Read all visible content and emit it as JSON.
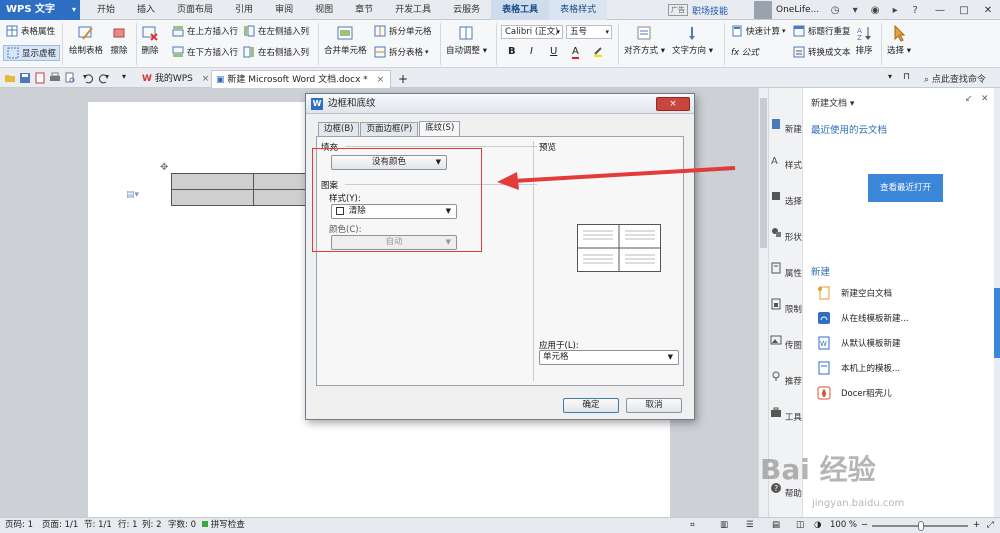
{
  "titlebar": {
    "app_name": "WPS 文字",
    "menu_tabs": [
      "开始",
      "插入",
      "页面布局",
      "引用",
      "审阅",
      "视图",
      "章节",
      "开发工具",
      "云服务",
      "表格工具",
      "表格样式"
    ],
    "ad_badge": "广告",
    "career_link": "职场技能",
    "user_name": "OneLife..."
  },
  "ribbon": {
    "table_props": "表格属性",
    "show_gridlines": "显示虚框",
    "draw_table": "绘制表格",
    "erase": "擦除",
    "delete": "删除",
    "insert_above": "在上方插入行",
    "insert_below": "在下方插入行",
    "insert_left": "在左侧插入列",
    "insert_right": "在右侧插入列",
    "merge_cells": "合并单元格",
    "split_cells": "拆分单元格",
    "split_table": "拆分表格",
    "auto_adjust": "自动调整",
    "font_name": "Calibri (正文)",
    "font_size": "五号",
    "bold": "B",
    "italic": "I",
    "underline": "U",
    "font_color": "A",
    "align": "对齐方式",
    "text_direction": "文字方向",
    "formula": "fx 公式",
    "quick_calc": "快速计算",
    "repeat_header": "标题行重复",
    "convert_text": "转换成文本",
    "sort": "排序",
    "select": "选择"
  },
  "tabs": {
    "my_wps": "我的WPS",
    "doc_name": "新建 Microsoft Word 文档.docx *",
    "add": "+",
    "search_cmd": "点此查找命令"
  },
  "dialog": {
    "title": "边框和底纹",
    "close": "×",
    "tabs": [
      "边框(B)",
      "页面边框(P)",
      "底纹(S)"
    ],
    "fill_label": "填充",
    "fill_value": "没有颜色",
    "pattern_label": "图案",
    "style_label": "样式(Y):",
    "style_value": "清除",
    "color_label": "颜色(C):",
    "color_value": "自动",
    "preview_label": "预览",
    "apply_label": "应用于(L):",
    "apply_value": "单元格",
    "ok": "确定",
    "cancel": "取消"
  },
  "side_strip": [
    "新建",
    "样式",
    "选择",
    "形状",
    "属性",
    "限制",
    "传图",
    "推荐",
    "工具",
    "帮助"
  ],
  "side_panel": {
    "title": "新建文档",
    "cloud_title": "最近使用的云文档",
    "view_recent": "查看最近打开",
    "new_title": "新建",
    "rows": [
      "新建空白文档",
      "从在线模板新建...",
      "从默认模板新建",
      "本机上的模板...",
      "Docer稻壳儿"
    ]
  },
  "status": {
    "page_num": "页码: 1",
    "pages": "页面: 1/1",
    "section": "节: 1/1",
    "row": "行: 1",
    "col": "列: 2",
    "words": "字数: 0",
    "spell": "拼写检查",
    "zoom": "100 %"
  },
  "watermark": {
    "text": "Bai 经验",
    "sub": "jingyan.baidu.com"
  },
  "colors": {
    "accent": "#2e6fc4",
    "annotation": "#e23b3b"
  }
}
